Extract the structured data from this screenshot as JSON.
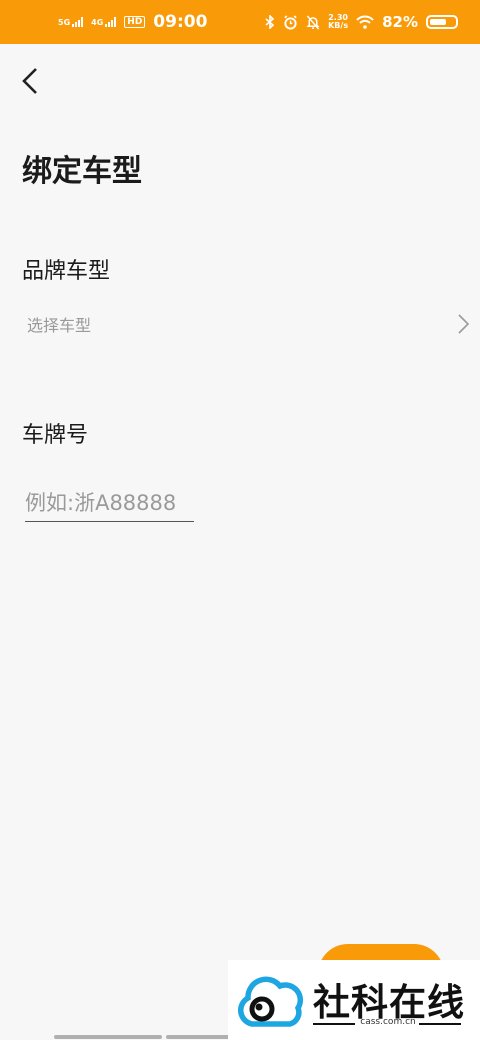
{
  "status_bar": {
    "network1": "5G",
    "network2": "4G",
    "hd": "HD",
    "time": "09:00",
    "speed_value": "2.30",
    "speed_unit": "KB/s",
    "battery_percent": "82%",
    "battery_level": 0.82
  },
  "header": {
    "title": "绑定车型"
  },
  "form": {
    "brand_label": "品牌车型",
    "brand_select_placeholder": "选择车型",
    "plate_label": "车牌号",
    "plate_placeholder": "例如:浙A88888",
    "plate_value": ""
  },
  "watermark": {
    "text": "社科在线",
    "domain": "cass.com.cn"
  },
  "colors": {
    "accent": "#f99b09",
    "background": "#f7f7f7",
    "placeholder": "#9a9a9a",
    "watermark_logo": "#1ea6e3"
  }
}
